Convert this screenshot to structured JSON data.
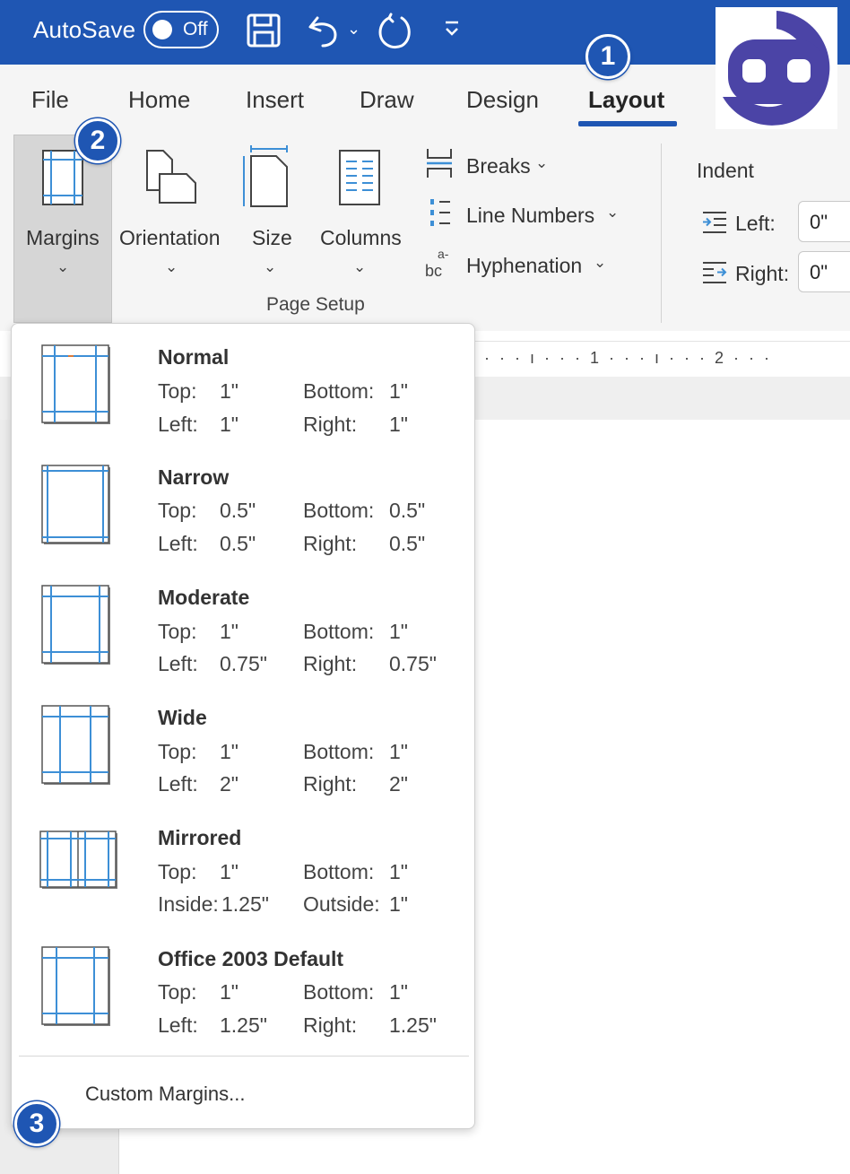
{
  "colors": {
    "accent": "#1f56b3",
    "logo": "#4b44a6",
    "margin_guide": "#3d8fd6"
  },
  "titlebar": {
    "autosave_label": "AutoSave",
    "toggle_state": "Off",
    "icons": [
      "save-icon",
      "undo-icon",
      "redo-icon",
      "customize-quick-access-icon"
    ]
  },
  "tabs": [
    {
      "label": "File"
    },
    {
      "label": "Home"
    },
    {
      "label": "Insert"
    },
    {
      "label": "Draw"
    },
    {
      "label": "Design"
    },
    {
      "label": "Layout",
      "active": true
    }
  ],
  "ribbon": {
    "margins": "Margins",
    "orientation": "Orientation",
    "size": "Size",
    "columns": "Columns",
    "breaks": "Breaks",
    "line_numbers": "Line Numbers",
    "hyphenation": "Hyphenation",
    "group_label": "Page Setup",
    "indent": {
      "heading": "Indent",
      "left_label": "Left:",
      "left_value": "0\"",
      "right_label": "Right:",
      "right_value": "0\""
    }
  },
  "ruler": {
    "text": "· · · ı · · · 1 · · · ı · · · 2 · · ·"
  },
  "margins_menu": {
    "options": [
      {
        "name": "Normal",
        "top_label": "Top:",
        "top": "1\"",
        "bottom_label": "Bottom:",
        "bottom": "1\"",
        "left_label": "Left:",
        "left": "1\"",
        "right_label": "Right:",
        "right": "1\""
      },
      {
        "name": "Narrow",
        "top_label": "Top:",
        "top": "0.5\"",
        "bottom_label": "Bottom:",
        "bottom": "0.5\"",
        "left_label": "Left:",
        "left": "0.5\"",
        "right_label": "Right:",
        "right": "0.5\""
      },
      {
        "name": "Moderate",
        "top_label": "Top:",
        "top": "1\"",
        "bottom_label": "Bottom:",
        "bottom": "1\"",
        "left_label": "Left:",
        "left": "0.75\"",
        "right_label": "Right:",
        "right": "0.75\""
      },
      {
        "name": "Wide",
        "top_label": "Top:",
        "top": "1\"",
        "bottom_label": "Bottom:",
        "bottom": "1\"",
        "left_label": "Left:",
        "left": "2\"",
        "right_label": "Right:",
        "right": "2\""
      },
      {
        "name": "Mirrored",
        "top_label": "Top:",
        "top": "1\"",
        "bottom_label": "Bottom:",
        "bottom": "1\"",
        "left_label": "Inside:",
        "left": "1.25\"",
        "right_label": "Outside:",
        "right": "1\""
      },
      {
        "name": "Office 2003 Default",
        "top_label": "Top:",
        "top": "1\"",
        "bottom_label": "Bottom:",
        "bottom": "1\"",
        "left_label": "Left:",
        "left": "1.25\"",
        "right_label": "Right:",
        "right": "1.25\""
      }
    ],
    "custom": "Custom Margins..."
  },
  "callouts": [
    "1",
    "2",
    "3"
  ]
}
